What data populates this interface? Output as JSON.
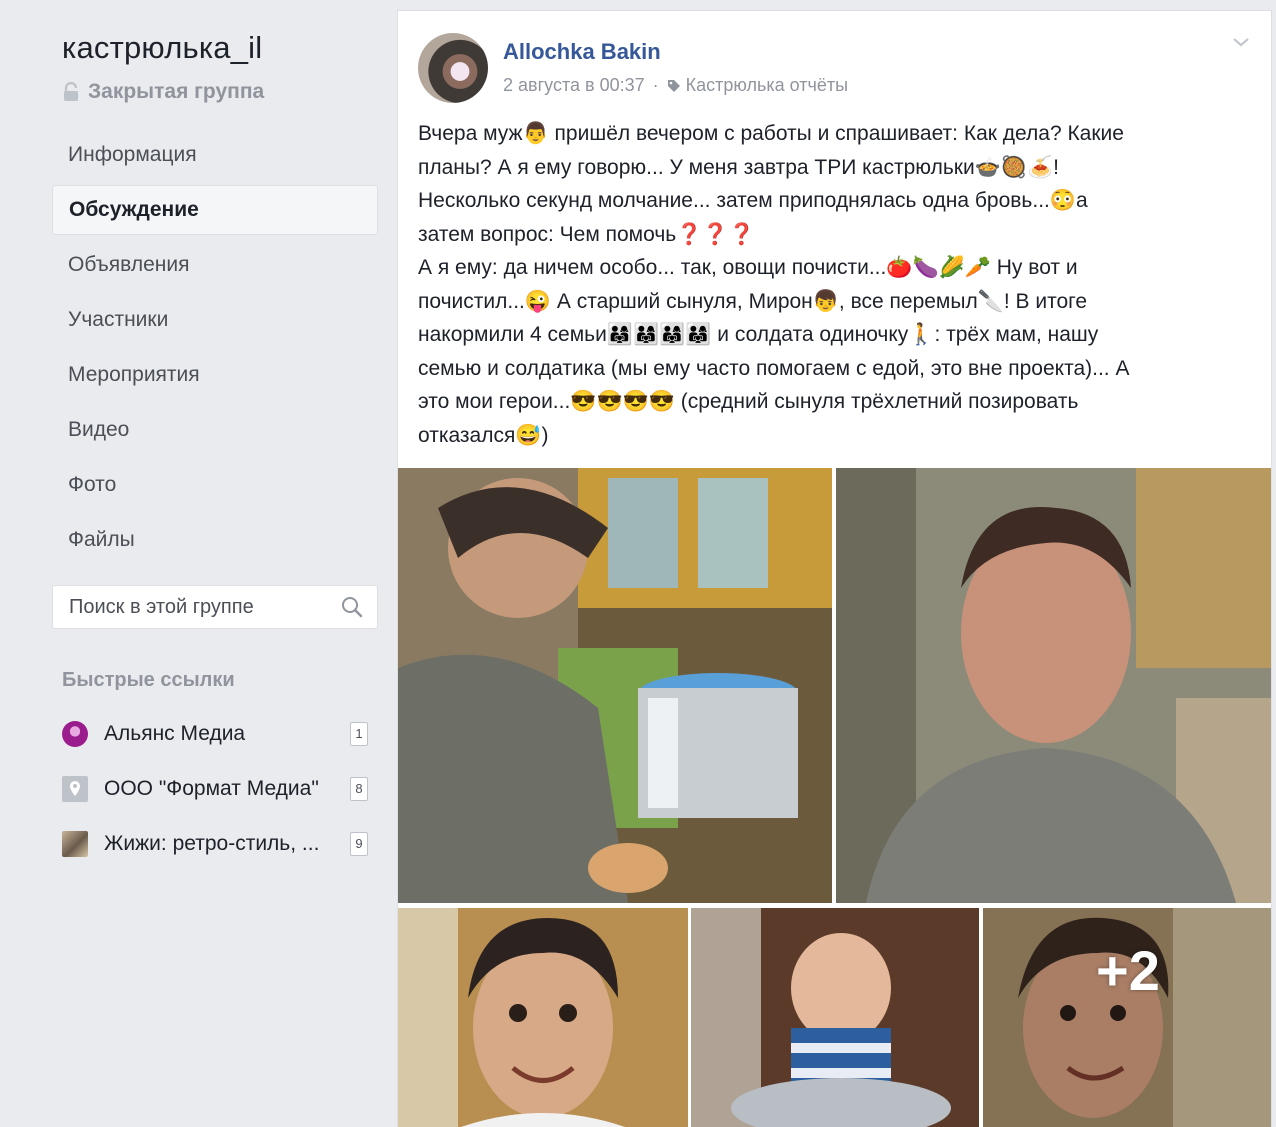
{
  "group": {
    "name": "кастрюлька_il",
    "type": "Закрытая группа"
  },
  "nav": [
    {
      "label": "Информация",
      "active": false
    },
    {
      "label": "Обсуждение",
      "active": true
    },
    {
      "label": "Объявления",
      "active": false
    },
    {
      "label": "Участники",
      "active": false
    },
    {
      "label": "Мероприятия",
      "active": false
    },
    {
      "label": "Видео",
      "active": false
    },
    {
      "label": "Фото",
      "active": false
    },
    {
      "label": "Файлы",
      "active": false
    }
  ],
  "search": {
    "placeholder": "Поиск в этой группе"
  },
  "quick_links": {
    "title": "Быстрые ссылки",
    "items": [
      {
        "label": "Альянс Медиа",
        "count": "1",
        "icon": "purple-circle-icon"
      },
      {
        "label": "ООО \"Формат Медиа\"",
        "count": "8",
        "icon": "map-pin-icon"
      },
      {
        "label": "Жижи: ретро-стиль, ...",
        "count": "9",
        "icon": "photo-thumb-icon"
      }
    ]
  },
  "post": {
    "author": "Allochka Bakin",
    "date": "2 августа в 00:37",
    "separator": "·",
    "tag": "Кастрюлька отчёты",
    "text_lines": [
      "Вчера муж👨 пришёл вечером с работы и спрашивает: Как дела? Какие",
      "планы? А я ему говорю... У меня завтра ТРИ кастрюльки🍲🥘🍝!",
      "Несколько секунд молчание... затем приподнялась одна бровь...😳а",
      "затем вопрос: Чем помочь❓❓❓",
      "А я ему: да ничем особо... так, овощи почисти...🍅🍆🌽🥕 Ну вот и",
      "почистил...😜 А старший сынуля, Мирон👦, все перемыл🔪! В итоге",
      "накормили 4 семьи👨‍👩‍👧👨‍👩‍👧👨‍👩‍👧👨‍👩‍👧 и солдата одиночку🚶: трёх мам, нашу",
      "семью и солдатика (мы ему часто помогаем с едой, это вне проекта)... А",
      "это мои герои...😎😎😎😎 (средний сынуля трёхлетний позировать",
      "отказался😅)"
    ],
    "more_photos": "+2"
  },
  "colors": {
    "page_bg": "#e9ebee",
    "link_blue": "#365899",
    "muted_gray": "#90949c"
  }
}
